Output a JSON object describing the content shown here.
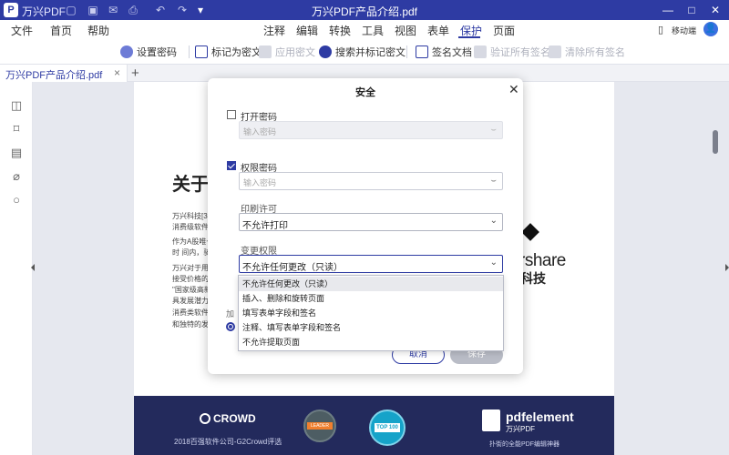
{
  "titlebar": {
    "app_name": "万兴PDF",
    "doc_title": "万兴PDF产品介绍.pdf",
    "logo_glyph": "P"
  },
  "menubar": {
    "items": [
      "文件",
      "首页",
      "帮助",
      "注释",
      "编辑",
      "转换",
      "工具",
      "视图",
      "表单",
      "保护",
      "页面"
    ],
    "active": "保护",
    "device_label": "移动端"
  },
  "toolbar": {
    "set_password": "设置密码",
    "mark_redaction": "标记为密文",
    "apply_redaction": "应用密文",
    "search_mark_redaction": "搜索并标记密文",
    "sign_document": "签名文档",
    "verify_signatures": "验证所有签名",
    "clear_signatures": "清除所有签名"
  },
  "tab": {
    "label": "万兴PDF产品介绍.pdf",
    "close_glyph": "×",
    "new_tab_glyph": "+"
  },
  "document": {
    "heading": "关于",
    "para1_line1": "万兴科技[30",
    "para1_line2": "消费级软件,",
    "para2_line1": "作为A股唯一",
    "para2_line2": "时 间内，骑",
    "para3_line1": "万兴对于用户",
    "para3_line2": "接受价格的平",
    "para3_line3": "\"国家级高新",
    "para3_line4": "具发展潜力企",
    "para3_line5": "消费类软件,",
    "para3_line6": "和独特的发展",
    "brand_text": "rshare",
    "brand_cn": "科技",
    "footer": {
      "g2_label": "CROWD",
      "g2_caption": "2018百强软件公司-G2Crowd评选",
      "leader_badge": "LEADER",
      "top100_badge": "TOP 100",
      "pe_name": "pdfelement",
      "pe_cn": "万兴PDF",
      "pe_tagline": "扑街的全能PDF编辑神器"
    }
  },
  "dialog": {
    "title": "安全",
    "open_password": {
      "label": "打开密码",
      "checked": false,
      "placeholder": "输入密码"
    },
    "permission_password": {
      "label": "权限密码",
      "checked": true,
      "placeholder": "输入密码"
    },
    "print_permission": {
      "label": "印刷许可",
      "value": "不允许打印"
    },
    "change_permission": {
      "label": "变更权限",
      "value": "不允许任何更改（只读）",
      "options": [
        "不允许任何更改（只读）",
        "插入、删除和旋转页面",
        "填写表单字段和签名",
        "注释、填写表单字段和签名",
        "不允许提取页面"
      ]
    },
    "hidden_label_peek": "加",
    "cancel_button": "取消",
    "save_button": "保存"
  },
  "colors": {
    "brand": "#2e3ba3",
    "footer_bg": "#232a5c"
  }
}
